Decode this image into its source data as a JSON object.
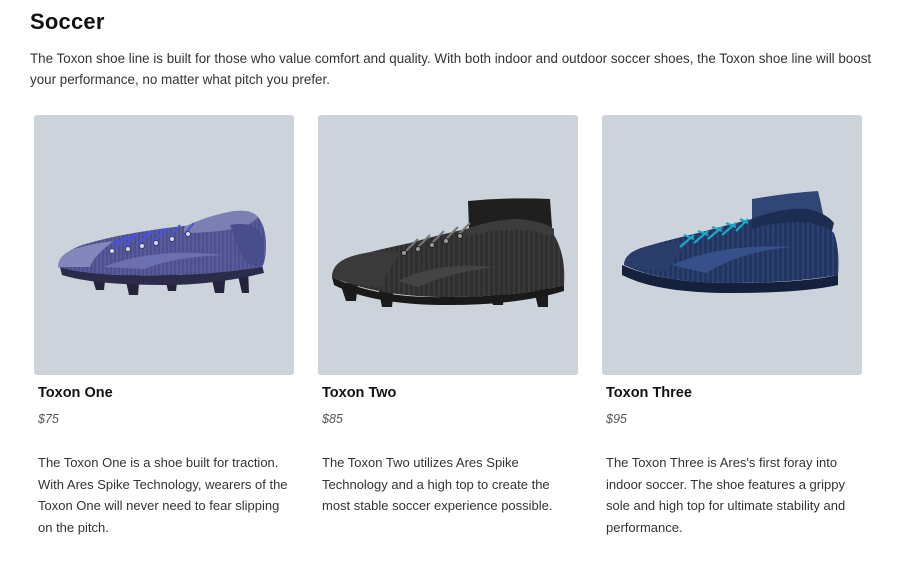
{
  "page": {
    "title": "Soccer",
    "intro": "The Toxon shoe line is built for those who value comfort and quality. With both indoor and outdoor soccer shoes, the Toxon shoe line will boost your performance, no matter what pitch you prefer."
  },
  "products": [
    {
      "name": "Toxon One",
      "price": "$75",
      "description": "The Toxon One is a shoe built for traction. With Ares Spike Technology, wearers of the Toxon One will never need to fear slipping on the pitch.",
      "image": "purple-cleat-low"
    },
    {
      "name": "Toxon Two",
      "price": "$85",
      "description": "The Toxon Two utilizes Ares Spike Technology and a high top to create the most stable soccer experience possible.",
      "image": "black-cleat-high-top"
    },
    {
      "name": "Toxon Three",
      "price": "$95",
      "description": "The Toxon Three is Ares's first foray into indoor soccer. The shoe features a grippy sole and high top for ultimate stability and performance.",
      "image": "navy-indoor-shoe-high-top"
    }
  ],
  "colors": {
    "image_background": "#cdd3da",
    "toxon_one_upper": "#5a5d98",
    "toxon_one_laces": "#4a52d8",
    "toxon_two_upper": "#2f2f2f",
    "toxon_three_upper": "#223560",
    "toxon_three_laces": "#1aa8c6"
  }
}
